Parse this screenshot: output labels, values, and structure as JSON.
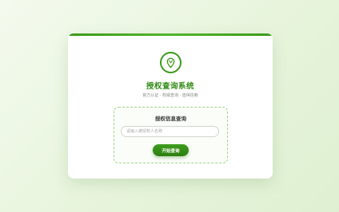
{
  "app": {
    "title": "授权查询系统",
    "subtitle": "官方认证 · 权威查询 · 值得信赖",
    "accent_color": "#3a9a1a",
    "logo_icon": "location-pin-icon"
  },
  "query": {
    "title": "授权信息查询",
    "input_placeholder": "请输入被授权人名称",
    "input_value": "",
    "button_label": "开始查询"
  }
}
